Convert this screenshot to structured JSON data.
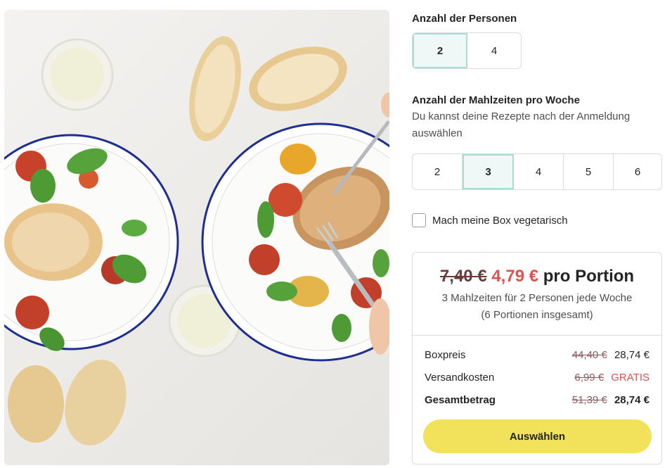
{
  "persons": {
    "label": "Anzahl der Personen",
    "options": [
      "2",
      "4"
    ],
    "selected": "2"
  },
  "meals": {
    "label": "Anzahl der Mahlzeiten pro Woche",
    "hint": "Du kannst deine Rezepte nach der Anmeldung auswählen",
    "options": [
      "2",
      "3",
      "4",
      "5",
      "6"
    ],
    "selected": "3"
  },
  "vegetarian": {
    "label": "Mach meine Box vegetarisch",
    "checked": false
  },
  "price": {
    "old": "7,40 €",
    "new": "4,79 €",
    "unit": "pro Portion",
    "summary_line1": "3 Mahlzeiten für 2 Personen jede Woche",
    "summary_line2": "(6 Portionen insgesamt)",
    "rows": [
      {
        "label": "Boxpreis",
        "old": "44,40 €",
        "value": "28,74 €"
      },
      {
        "label": "Versandkosten",
        "old": "6,99 €",
        "value": "GRATIS"
      },
      {
        "label": "Gesamtbetrag",
        "old": "51,39 €",
        "value": "28,74 €"
      }
    ],
    "cta": "Auswählen"
  },
  "colors": {
    "accent_border": "#a9dcd3",
    "selected_bg": "#f0f8f7",
    "price_red": "#d9534f",
    "button_yellow": "#f1e15b"
  }
}
